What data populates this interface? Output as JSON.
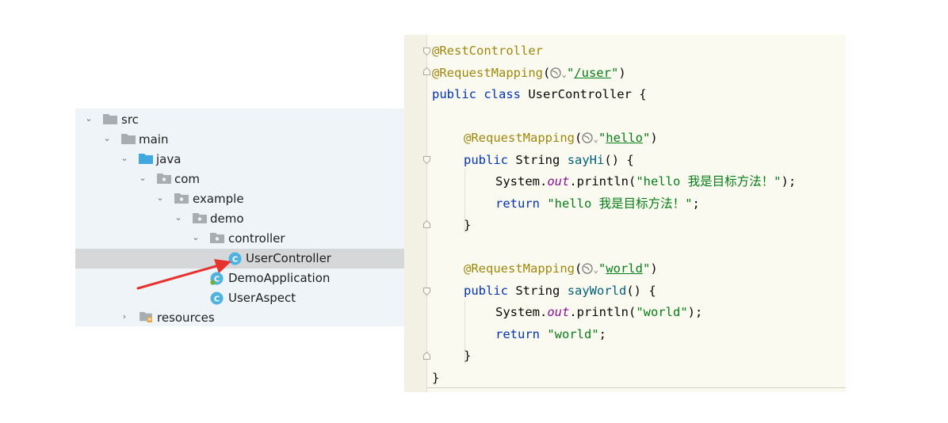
{
  "tree": {
    "items": [
      {
        "label": "src",
        "icon": "folder-icon",
        "expanded": true
      },
      {
        "label": "main",
        "icon": "folder-icon",
        "expanded": true
      },
      {
        "label": "java",
        "icon": "source-folder-icon",
        "expanded": true
      },
      {
        "label": "com",
        "icon": "package-icon",
        "expanded": true
      },
      {
        "label": "example",
        "icon": "package-icon",
        "expanded": true
      },
      {
        "label": "demo",
        "icon": "package-icon",
        "expanded": true
      },
      {
        "label": "controller",
        "icon": "package-icon",
        "expanded": true
      },
      {
        "label": "UserController",
        "icon": "class-icon",
        "selected": true
      },
      {
        "label": "DemoApplication",
        "icon": "spring-boot-class-icon"
      },
      {
        "label": "UserAspect",
        "icon": "class-icon"
      },
      {
        "label": "resources",
        "icon": "resources-folder-icon",
        "expanded": false
      }
    ]
  },
  "editor": {
    "ann_restcontroller": "@RestController",
    "ann_requestmapping": "@RequestMapping",
    "path_user": "/user",
    "class_decl_kw": "public class",
    "class_name": "UserController {",
    "path_hello": "hello",
    "kw_public": "public",
    "type_string": "String",
    "method_sayhi": "sayHi",
    "method_sayworld": "sayWorld",
    "params_open": "() {",
    "sys_prefix": "System.",
    "field_out": "out",
    "println": ".println(",
    "str_hello_prefix": "\"hello ",
    "str_hello_cn": "我是目标方法！",
    "str_quote": "\"",
    "kw_return": "return",
    "path_world": "world",
    "str_world": "\"world\"",
    "close_brace": "}",
    "stmt_end": ");",
    "semi": ";"
  },
  "colors": {
    "annotation": "#9e880d",
    "keyword": "#0033b3",
    "string": "#067d17",
    "method": "#00627a",
    "field": "#871094",
    "arrow": "#e8322e",
    "selection": "#d5d7d9"
  }
}
